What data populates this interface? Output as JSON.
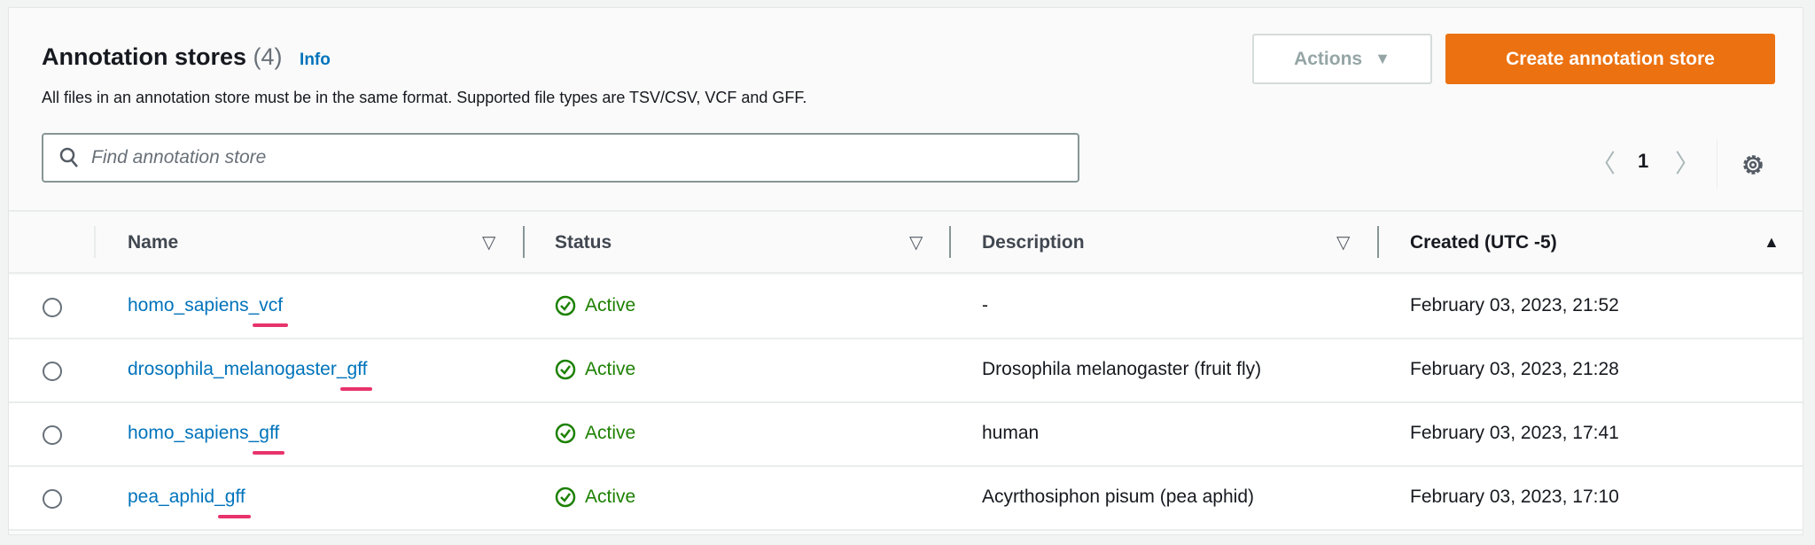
{
  "header": {
    "title": "Annotation stores",
    "count": "(4)",
    "info": "Info",
    "description": "All files in an annotation store must be in the same format. Supported file types are TSV/CSV, VCF and GFF."
  },
  "toolbar": {
    "actions_label": "Actions",
    "create_label": "Create annotation store"
  },
  "search": {
    "placeholder": "Find annotation store"
  },
  "pagination": {
    "current_page": "1"
  },
  "table": {
    "columns": [
      "Name",
      "Status",
      "Description",
      "Created (UTC -5)"
    ],
    "rows": [
      {
        "name_prefix": "homo_sapiens",
        "name_suffix": "_vcf",
        "status": "Active",
        "description": "-",
        "created": "February 03, 2023, 21:52"
      },
      {
        "name_prefix": "drosophila_melanogaster",
        "name_suffix": "_gff",
        "status": "Active",
        "description": "Drosophila melanogaster (fruit fly)",
        "created": "February 03, 2023, 21:28"
      },
      {
        "name_prefix": "homo_sapiens",
        "name_suffix": "_gff",
        "status": "Active",
        "description": "human",
        "created": "February 03, 2023, 17:41"
      },
      {
        "name_prefix": "pea_aphid",
        "name_suffix": "_gff",
        "status": "Active",
        "description": "Acyrthosiphon pisum (pea aphid)",
        "created": "February 03, 2023, 17:10"
      }
    ]
  },
  "colors": {
    "accent": "#ec7211",
    "link": "#0073bb",
    "success": "#1d8102",
    "highlight": "#e8336b"
  }
}
